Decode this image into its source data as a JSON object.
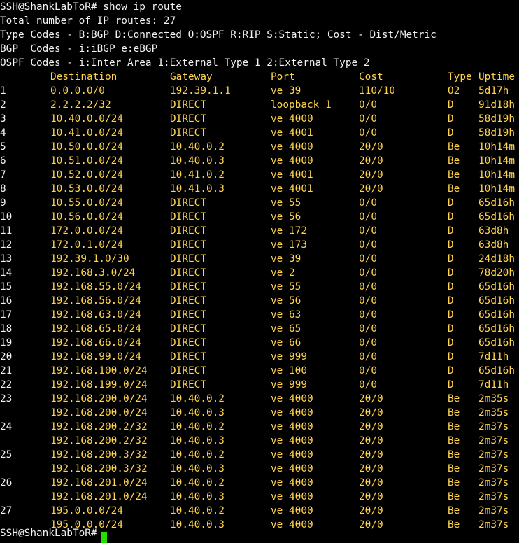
{
  "terminal": {
    "prompt_line": "SSH@ShankLabToR# show ip route",
    "total_line": "Total number of IP routes: 27",
    "type_codes_line": "Type Codes - B:BGP D:Connected O:OSPF R:RIP S:Static; Cost - Dist/Metric",
    "bgp_codes_line": "BGP  Codes - i:iBGP e:eBGP",
    "ospf_codes_line": "OSPF Codes - i:Inter Area 1:External Type 1 2:External Type 2",
    "next_prompt": "SSH@ShankLabToR#",
    "colors": {
      "background": "#000000",
      "text": "#f2f2f2",
      "data": "#ffd34d",
      "cursor": "#22e000"
    }
  },
  "table": {
    "headers": {
      "destination": "Destination",
      "gateway": "Gateway",
      "port": "Port",
      "cost": "Cost",
      "type": "Type",
      "uptime": "Uptime"
    },
    "rows": [
      {
        "num": "1",
        "destination": "0.0.0.0/0",
        "gateway": "192.39.1.1",
        "port": "ve 39",
        "cost": "110/10",
        "type": "O2",
        "uptime": "5d17h"
      },
      {
        "num": "2",
        "destination": "2.2.2.2/32",
        "gateway": "DIRECT",
        "port": "loopback 1",
        "cost": "0/0",
        "type": "D",
        "uptime": "91d18h"
      },
      {
        "num": "3",
        "destination": "10.40.0.0/24",
        "gateway": "DIRECT",
        "port": "ve 4000",
        "cost": "0/0",
        "type": "D",
        "uptime": "58d19h"
      },
      {
        "num": "4",
        "destination": "10.41.0.0/24",
        "gateway": "DIRECT",
        "port": "ve 4001",
        "cost": "0/0",
        "type": "D",
        "uptime": "58d19h"
      },
      {
        "num": "5",
        "destination": "10.50.0.0/24",
        "gateway": "10.40.0.2",
        "port": "ve 4000",
        "cost": "20/0",
        "type": "Be",
        "uptime": "10h14m"
      },
      {
        "num": "6",
        "destination": "10.51.0.0/24",
        "gateway": "10.40.0.3",
        "port": "ve 4000",
        "cost": "20/0",
        "type": "Be",
        "uptime": "10h14m"
      },
      {
        "num": "7",
        "destination": "10.52.0.0/24",
        "gateway": "10.41.0.2",
        "port": "ve 4001",
        "cost": "20/0",
        "type": "Be",
        "uptime": "10h14m"
      },
      {
        "num": "8",
        "destination": "10.53.0.0/24",
        "gateway": "10.41.0.3",
        "port": "ve 4001",
        "cost": "20/0",
        "type": "Be",
        "uptime": "10h14m"
      },
      {
        "num": "9",
        "destination": "10.55.0.0/24",
        "gateway": "DIRECT",
        "port": "ve 55",
        "cost": "0/0",
        "type": "D",
        "uptime": "65d16h"
      },
      {
        "num": "10",
        "destination": "10.56.0.0/24",
        "gateway": "DIRECT",
        "port": "ve 56",
        "cost": "0/0",
        "type": "D",
        "uptime": "65d16h"
      },
      {
        "num": "11",
        "destination": "172.0.0.0/24",
        "gateway": "DIRECT",
        "port": "ve 172",
        "cost": "0/0",
        "type": "D",
        "uptime": "63d8h"
      },
      {
        "num": "12",
        "destination": "172.0.1.0/24",
        "gateway": "DIRECT",
        "port": "ve 173",
        "cost": "0/0",
        "type": "D",
        "uptime": "63d8h"
      },
      {
        "num": "13",
        "destination": "192.39.1.0/30",
        "gateway": "DIRECT",
        "port": "ve 39",
        "cost": "0/0",
        "type": "D",
        "uptime": "24d18h"
      },
      {
        "num": "14",
        "destination": "192.168.3.0/24",
        "gateway": "DIRECT",
        "port": "ve 2",
        "cost": "0/0",
        "type": "D",
        "uptime": "78d20h"
      },
      {
        "num": "15",
        "destination": "192.168.55.0/24",
        "gateway": "DIRECT",
        "port": "ve 55",
        "cost": "0/0",
        "type": "D",
        "uptime": "65d16h"
      },
      {
        "num": "16",
        "destination": "192.168.56.0/24",
        "gateway": "DIRECT",
        "port": "ve 56",
        "cost": "0/0",
        "type": "D",
        "uptime": "65d16h"
      },
      {
        "num": "17",
        "destination": "192.168.63.0/24",
        "gateway": "DIRECT",
        "port": "ve 63",
        "cost": "0/0",
        "type": "D",
        "uptime": "65d16h"
      },
      {
        "num": "18",
        "destination": "192.168.65.0/24",
        "gateway": "DIRECT",
        "port": "ve 65",
        "cost": "0/0",
        "type": "D",
        "uptime": "65d16h"
      },
      {
        "num": "19",
        "destination": "192.168.66.0/24",
        "gateway": "DIRECT",
        "port": "ve 66",
        "cost": "0/0",
        "type": "D",
        "uptime": "65d16h"
      },
      {
        "num": "20",
        "destination": "192.168.99.0/24",
        "gateway": "DIRECT",
        "port": "ve 999",
        "cost": "0/0",
        "type": "D",
        "uptime": "7d11h"
      },
      {
        "num": "21",
        "destination": "192.168.100.0/24",
        "gateway": "DIRECT",
        "port": "ve 100",
        "cost": "0/0",
        "type": "D",
        "uptime": "65d16h"
      },
      {
        "num": "22",
        "destination": "192.168.199.0/24",
        "gateway": "DIRECT",
        "port": "ve 999",
        "cost": "0/0",
        "type": "D",
        "uptime": "7d11h"
      },
      {
        "num": "23",
        "destination": "192.168.200.0/24",
        "gateway": "10.40.0.2",
        "port": "ve 4000",
        "cost": "20/0",
        "type": "Be",
        "uptime": "2m35s"
      },
      {
        "num": "",
        "destination": "192.168.200.0/24",
        "gateway": "10.40.0.3",
        "port": "ve 4000",
        "cost": "20/0",
        "type": "Be",
        "uptime": "2m35s"
      },
      {
        "num": "24",
        "destination": "192.168.200.2/32",
        "gateway": "10.40.0.2",
        "port": "ve 4000",
        "cost": "20/0",
        "type": "Be",
        "uptime": "2m37s"
      },
      {
        "num": "",
        "destination": "192.168.200.2/32",
        "gateway": "10.40.0.3",
        "port": "ve 4000",
        "cost": "20/0",
        "type": "Be",
        "uptime": "2m37s"
      },
      {
        "num": "25",
        "destination": "192.168.200.3/32",
        "gateway": "10.40.0.2",
        "port": "ve 4000",
        "cost": "20/0",
        "type": "Be",
        "uptime": "2m37s"
      },
      {
        "num": "",
        "destination": "192.168.200.3/32",
        "gateway": "10.40.0.3",
        "port": "ve 4000",
        "cost": "20/0",
        "type": "Be",
        "uptime": "2m37s"
      },
      {
        "num": "26",
        "destination": "192.168.201.0/24",
        "gateway": "10.40.0.2",
        "port": "ve 4000",
        "cost": "20/0",
        "type": "Be",
        "uptime": "2m37s"
      },
      {
        "num": "",
        "destination": "192.168.201.0/24",
        "gateway": "10.40.0.3",
        "port": "ve 4000",
        "cost": "20/0",
        "type": "Be",
        "uptime": "2m37s"
      },
      {
        "num": "27",
        "destination": "195.0.0.0/24",
        "gateway": "10.40.0.2",
        "port": "ve 4000",
        "cost": "20/0",
        "type": "Be",
        "uptime": "2m37s"
      },
      {
        "num": "",
        "destination": "195.0.0.0/24",
        "gateway": "10.40.0.3",
        "port": "ve 4000",
        "cost": "20/0",
        "type": "Be",
        "uptime": "2m37s"
      }
    ]
  }
}
